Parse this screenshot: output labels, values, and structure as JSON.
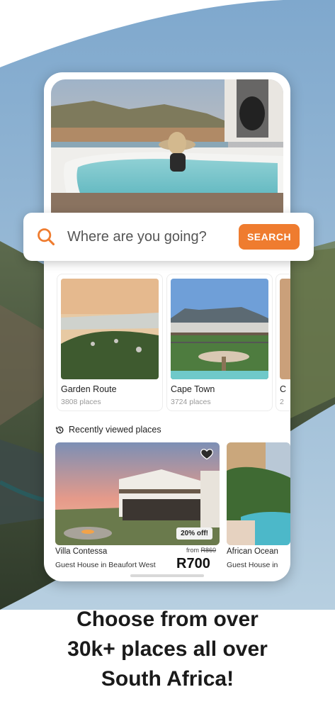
{
  "search": {
    "placeholder": "Where are you going?",
    "button_label": "SEARCH"
  },
  "destinations": [
    {
      "name": "Garden Route",
      "count": "3808 places"
    },
    {
      "name": "Cape Town",
      "count": "3724 places"
    },
    {
      "name": "C",
      "count": "2"
    }
  ],
  "recent": {
    "title": "Recently viewed places",
    "places": [
      {
        "name": "Villa Contessa",
        "type": "Guest House in Beaufort West",
        "discount": "20% off!",
        "from_label": "from",
        "old_price": "R860",
        "price": "R700"
      },
      {
        "name": "African Ocean",
        "type": "Guest House in"
      }
    ]
  },
  "headline": [
    "Choose from over",
    "30k+ places all over",
    "South Africa!"
  ],
  "colors": {
    "accent": "#ef7c2f"
  }
}
